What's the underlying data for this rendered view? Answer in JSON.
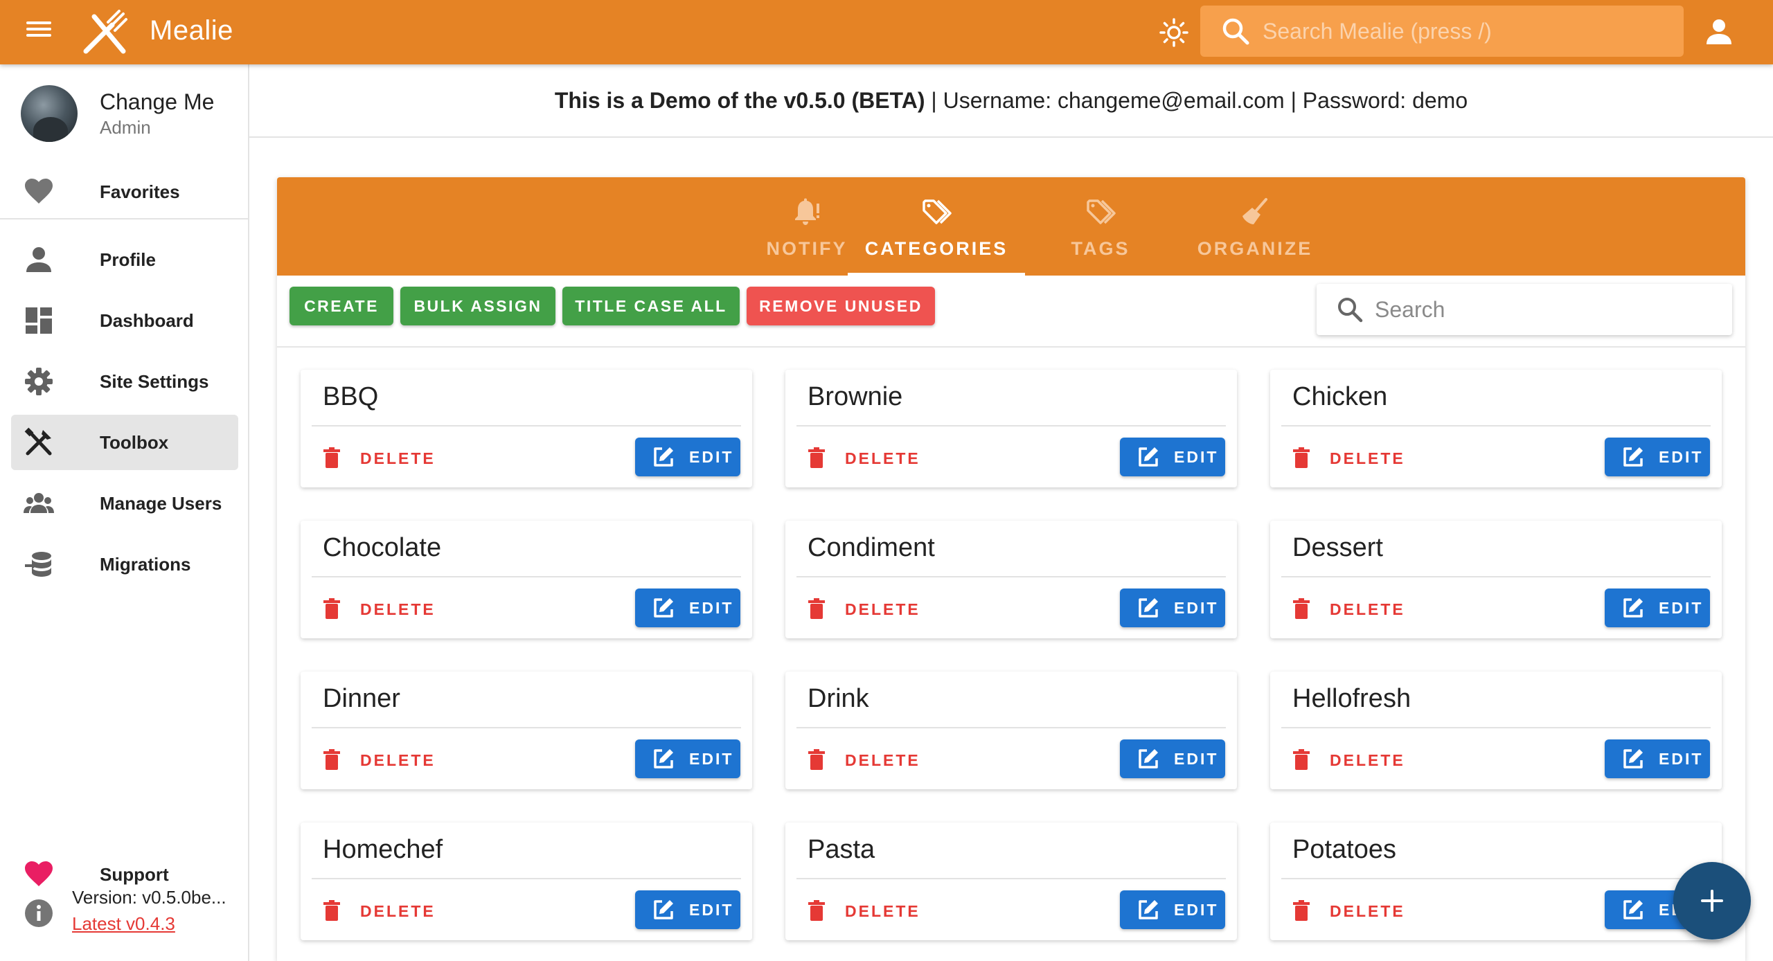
{
  "app": {
    "brand": "Mealie",
    "search_placeholder": "Search Mealie (press /)"
  },
  "sidebar": {
    "user_name": "Change Me",
    "user_role": "Admin",
    "favorites": "Favorites",
    "items": [
      {
        "label": "Profile",
        "icon": "account-icon"
      },
      {
        "label": "Dashboard",
        "icon": "dashboard-icon"
      },
      {
        "label": "Site Settings",
        "icon": "gear-icon"
      },
      {
        "label": "Toolbox",
        "icon": "tools-icon"
      },
      {
        "label": "Manage Users",
        "icon": "users-icon"
      },
      {
        "label": "Migrations",
        "icon": "database-import-icon"
      }
    ],
    "active_item": "Toolbox",
    "support": "Support",
    "version": "Version: v0.5.0be...",
    "latest": "Latest v0.4.3"
  },
  "banner": {
    "bold": "This is a Demo of the v0.5.0 (BETA)",
    "rest": " | Username: changeme@email.com | Password: demo"
  },
  "tabs": [
    {
      "label": "NOTIFY",
      "icon": "bell-alert-icon"
    },
    {
      "label": "CATEGORIES",
      "icon": "tags-icon"
    },
    {
      "label": "TAGS",
      "icon": "tags-outline-icon"
    },
    {
      "label": "ORGANIZE",
      "icon": "broom-icon"
    }
  ],
  "active_tab": "CATEGORIES",
  "toolbar": {
    "create": "CREATE",
    "bulk_assign": "BULK ASSIGN",
    "title_case": "TITLE CASE ALL",
    "remove_unused": "REMOVE UNUSED",
    "search_placeholder": "Search"
  },
  "card_actions": {
    "delete": "DELETE",
    "edit": "EDIT"
  },
  "categories": [
    "BBQ",
    "Brownie",
    "Chicken",
    "Chocolate",
    "Condiment",
    "Dessert",
    "Dinner",
    "Drink",
    "Hellofresh",
    "Homechef",
    "Pasta",
    "Potatoes"
  ],
  "colors": {
    "primary": "#e58325",
    "create_green": "#43a047",
    "remove_red": "#ef5350",
    "edit_blue": "#1e74d1",
    "delete_red": "#e53935",
    "fab": "#1b4f7a",
    "support_heart": "#e91e63"
  }
}
